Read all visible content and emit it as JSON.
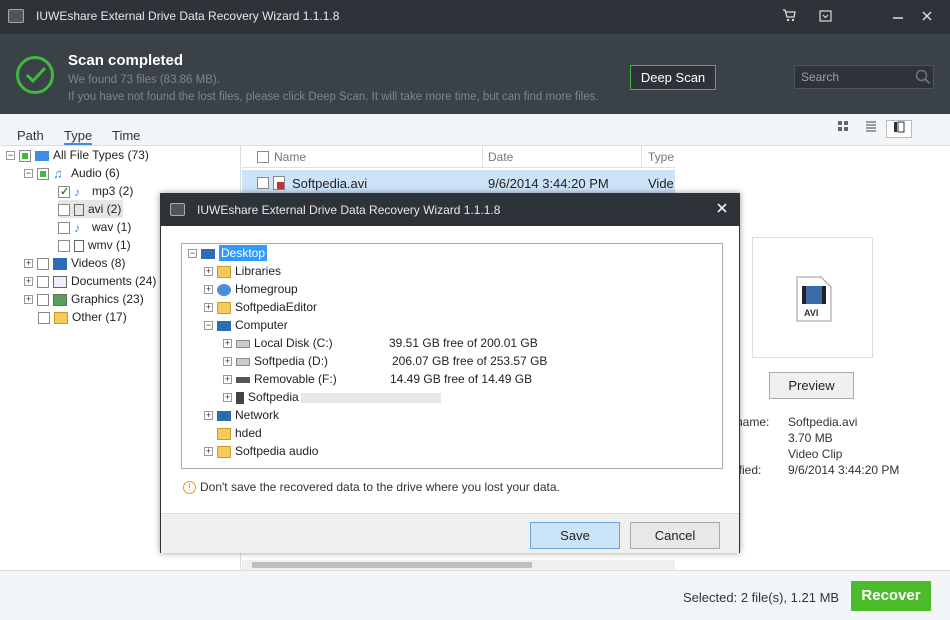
{
  "window": {
    "title": "IUWEshare External Drive Data Recovery Wizard 1.1.1.8"
  },
  "header": {
    "title": "Scan completed",
    "found": "We found 73 files (83.86 MB).",
    "hint": "If you have not found the lost files, please click Deep Scan. It will take more time, but can find more files.",
    "deep_scan": "Deep Scan",
    "search_placeholder": "Search"
  },
  "tabs": [
    "Path",
    "Type",
    "Time"
  ],
  "tree": {
    "root": "All File Types (73)",
    "audio": "Audio (6)",
    "mp3": "mp3 (2)",
    "avi": "avi (2)",
    "wav": "wav (1)",
    "wmv": "wmv (1)",
    "videos": "Videos (8)",
    "documents": "Documents (24)",
    "graphics": "Graphics (23)",
    "other": "Other (17)"
  },
  "list": {
    "columns": [
      "Name",
      "Date",
      "Type"
    ],
    "rows": [
      {
        "name": "Softpedia.avi",
        "date": "9/6/2014 3:44:20 PM",
        "type": "Vide"
      }
    ]
  },
  "details": {
    "preview_button": "Preview",
    "file_ext": "AVI",
    "labels": [
      "name:",
      ":",
      ":",
      "ified:"
    ],
    "values": [
      "Softpedia.avi",
      "3.70 MB",
      "Video Clip",
      "9/6/2014 3:44:20 PM"
    ]
  },
  "bottom": {
    "selected": "Selected: 2 file(s), 1.21 MB",
    "recover": "Recover"
  },
  "dialog": {
    "title": "IUWEshare External Drive Data Recovery Wizard 1.1.1.8",
    "tree": {
      "desktop": "Desktop",
      "libraries": "Libraries",
      "homegroup": "Homegroup",
      "softpediaeditor": "SoftpediaEditor",
      "computer": "Computer",
      "drive_c": "Local Disk (C:)",
      "drive_c_space": "39.51 GB free of 200.01 GB",
      "drive_d": "Softpedia (D:)",
      "drive_d_space": "206.07 GB free of 253.57 GB",
      "drive_f": "Removable (F:)",
      "drive_f_space": "14.49 GB free of 14.49 GB",
      "phone": "Softpedia",
      "network": "Network",
      "hded": "hded",
      "softpedia_audio": "Softpedia audio"
    },
    "warning": "Don't save the recovered data to the drive where you lost your data.",
    "save": "Save",
    "cancel": "Cancel"
  }
}
